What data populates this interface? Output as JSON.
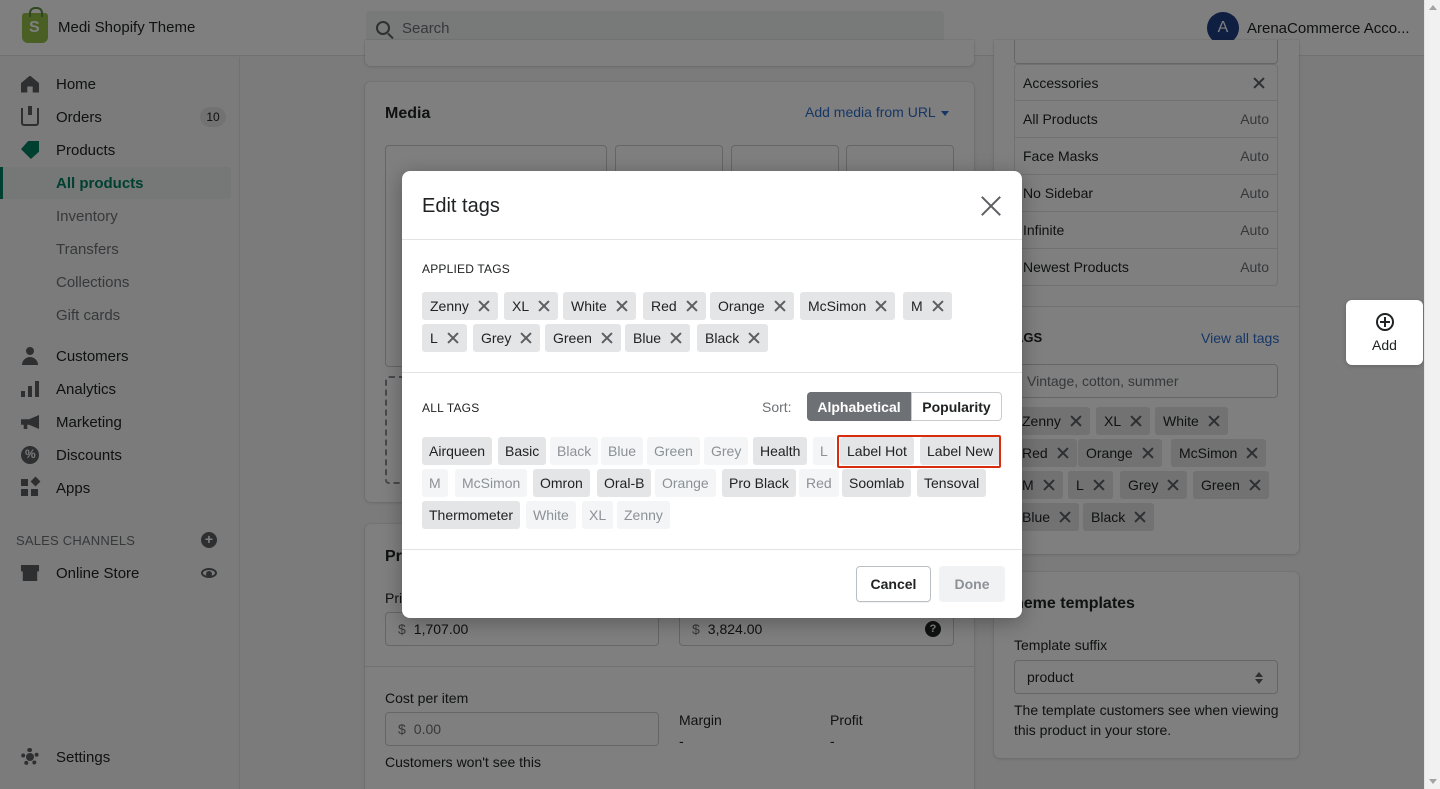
{
  "app": {
    "title": "Medi Shopify Theme",
    "search_placeholder": "Search",
    "account_initial": "A",
    "account_name": "ArenaCommerce Acco..."
  },
  "sidebar": {
    "home": "Home",
    "orders": "Orders",
    "orders_badge": "10",
    "products": "Products",
    "sub": [
      "All products",
      "Inventory",
      "Transfers",
      "Collections",
      "Gift cards"
    ],
    "customers": "Customers",
    "analytics": "Analytics",
    "marketing": "Marketing",
    "discounts": "Discounts",
    "apps": "Apps",
    "sales_channels": "SALES CHANNELS",
    "online_store": "Online Store",
    "settings": "Settings"
  },
  "main": {
    "media_title": "Media",
    "add_media": "Add media from URL",
    "pricing_title": "Pri",
    "price_label": "Pric",
    "price_prefix": "$",
    "price_value": "1,707.00",
    "compare_value": "3,824.00",
    "cost_label": "Cost per item",
    "cost_placeholder": "0.00",
    "cost_help": "Customers won't see this",
    "margin_label": "Margin",
    "margin_value": "-",
    "profit_label": "Profit",
    "profit_value": "-"
  },
  "right": {
    "collections": [
      {
        "name": "Accessories",
        "status": ""
      },
      {
        "name": "All Products",
        "status": "Auto"
      },
      {
        "name": "Face Masks",
        "status": "Auto"
      },
      {
        "name": "No Sidebar",
        "status": "Auto"
      },
      {
        "name": "Infinite",
        "status": "Auto"
      },
      {
        "name": "Newest Products",
        "status": "Auto"
      }
    ],
    "tags_title": "AGS",
    "view_all_tags": "View all tags",
    "tags_placeholder": "Vintage, cotton, summer",
    "tags": [
      "Zenny",
      "XL",
      "White",
      "Red",
      "Orange",
      "McSimon",
      "M",
      "L",
      "Grey",
      "Green",
      "Blue",
      "Black"
    ],
    "theme_title": "heme templates",
    "template_label": "Template suffix",
    "template_value": "product",
    "template_help_1": "The template customers see when viewing",
    "template_help_2": "this product in your store."
  },
  "fab": {
    "label": "Add"
  },
  "modal": {
    "title": "Edit tags",
    "applied_heading": "APPLIED TAGS",
    "applied": [
      "Zenny",
      "XL",
      "White",
      "Red",
      "Orange",
      "McSimon",
      "M",
      "L",
      "Grey",
      "Green",
      "Blue",
      "Black"
    ],
    "all_heading": "ALL TAGS",
    "sort_label": "Sort:",
    "sort_options": [
      "Alphabetical",
      "Popularity"
    ],
    "sort_selected": "Alphabetical",
    "all_tags": [
      {
        "label": "Airqueen",
        "applied": false
      },
      {
        "label": "Basic",
        "applied": false
      },
      {
        "label": "Black",
        "applied": true
      },
      {
        "label": "Blue",
        "applied": true
      },
      {
        "label": "Green",
        "applied": true
      },
      {
        "label": "Grey",
        "applied": true
      },
      {
        "label": "Health",
        "applied": false
      },
      {
        "label": "L",
        "applied": true
      },
      {
        "label": "Label Hot",
        "applied": false
      },
      {
        "label": "Label New",
        "applied": false
      },
      {
        "label": "M",
        "applied": true
      },
      {
        "label": "McSimon",
        "applied": true
      },
      {
        "label": "Omron",
        "applied": false
      },
      {
        "label": "Oral-B",
        "applied": false
      },
      {
        "label": "Orange",
        "applied": true
      },
      {
        "label": "Pro Black",
        "applied": false
      },
      {
        "label": "Red",
        "applied": true
      },
      {
        "label": "Soomlab",
        "applied": false
      },
      {
        "label": "Tensoval",
        "applied": false
      },
      {
        "label": "Thermometer",
        "applied": false
      },
      {
        "label": "White",
        "applied": true
      },
      {
        "label": "XL",
        "applied": true
      },
      {
        "label": "Zenny",
        "applied": true
      }
    ],
    "cancel": "Cancel",
    "done": "Done"
  },
  "colors": {
    "accent_green": "#008060",
    "link_blue": "#2c6ecb",
    "highlight_red": "#d72c0d",
    "avatar_blue": "#1f3e82"
  }
}
